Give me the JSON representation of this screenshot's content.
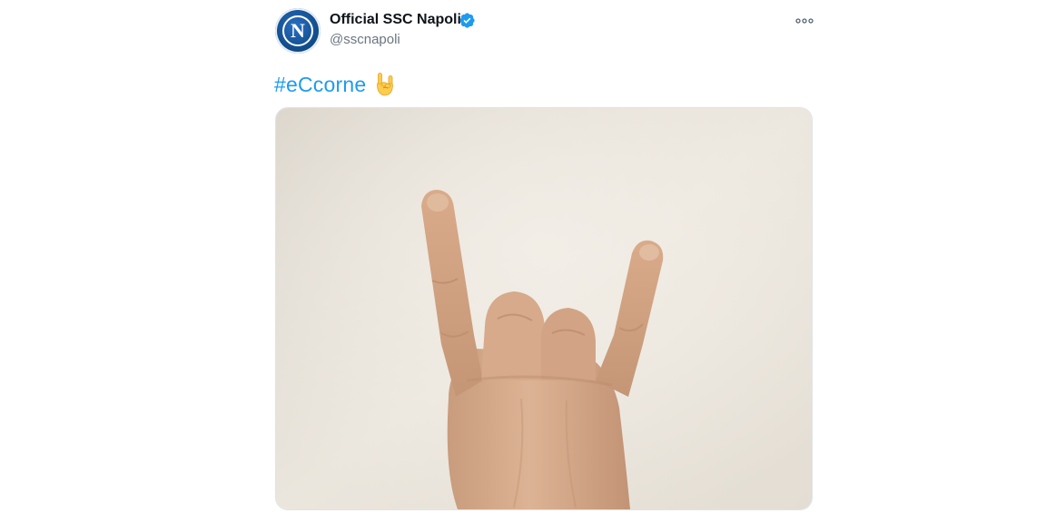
{
  "tweet": {
    "author": {
      "display_name": "Official SSC Napoli",
      "handle": "@sscnapoli",
      "avatar_letter": "N",
      "verified": true
    },
    "text": {
      "hashtag": "#eCcorne",
      "emoji": "sign-of-the-horns-emoji"
    },
    "media": {
      "type": "photo",
      "subject": "hand-horns-gesture"
    },
    "icons": {
      "more": "more-horizontal-icon",
      "verified": "verified-badge-icon"
    },
    "colors": {
      "accent": "#1d9bf0",
      "name": "#0f1419",
      "secondary_text": "#6b7580",
      "avatar_blue": "#13508f"
    }
  }
}
